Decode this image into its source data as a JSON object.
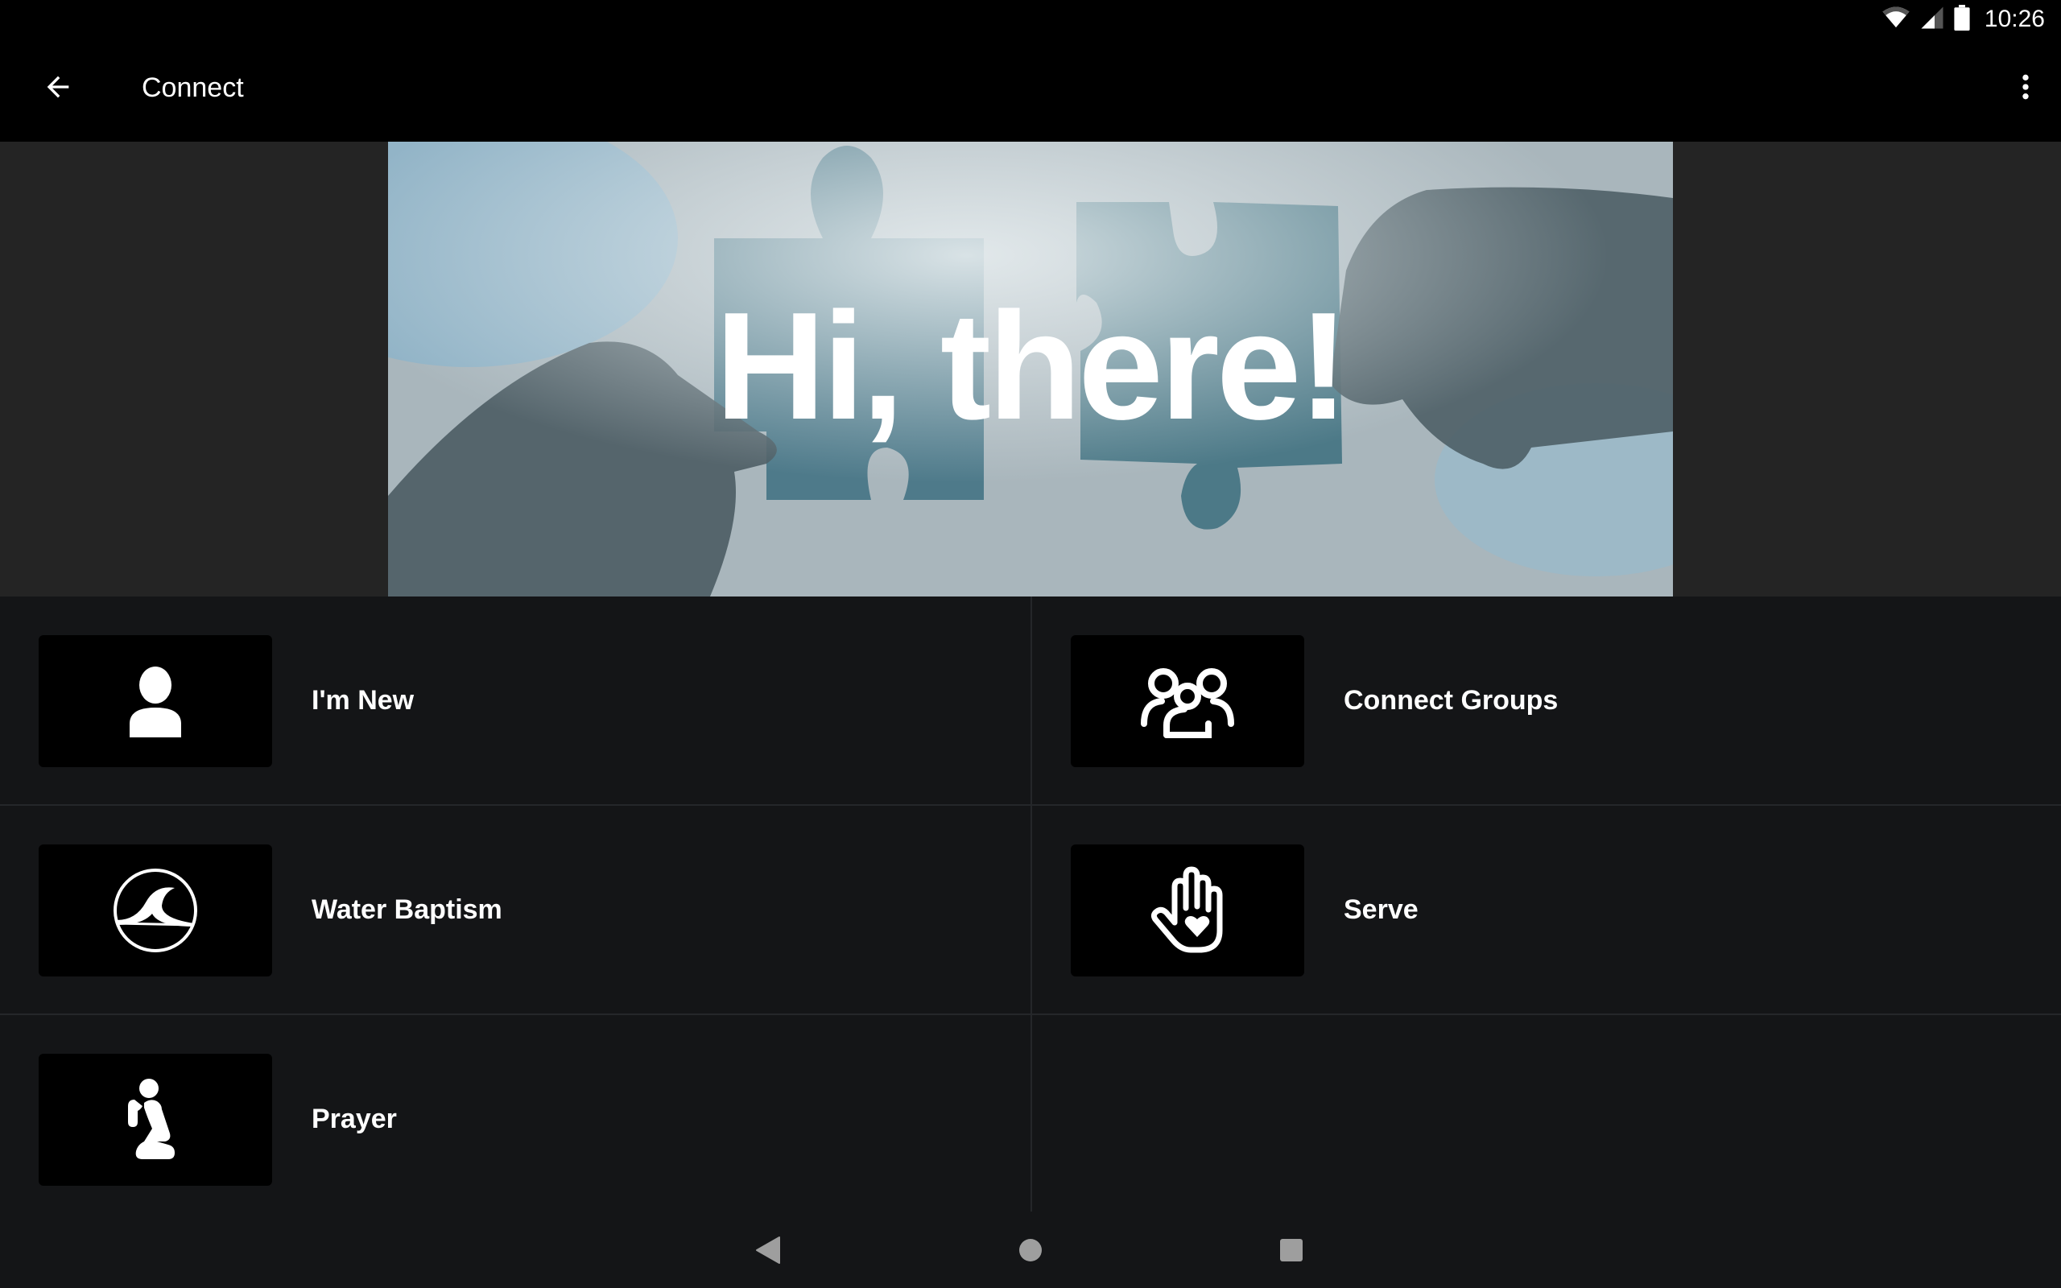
{
  "status_bar": {
    "time": "10:26",
    "icons": [
      "wifi-icon",
      "cell-signal-icon",
      "battery-icon"
    ]
  },
  "app_bar": {
    "title": "Connect",
    "back_icon": "arrow-left-icon",
    "menu_icon": "more-vertical-icon"
  },
  "banner": {
    "headline": "Hi, there!",
    "image_description": "two hands joining puzzle pieces against sky"
  },
  "items": [
    {
      "label": "I'm New",
      "icon": "person-icon"
    },
    {
      "label": "Connect Groups",
      "icon": "group-icon"
    },
    {
      "label": "Water Baptism",
      "icon": "wave-circle-icon"
    },
    {
      "label": "Serve",
      "icon": "hand-heart-icon"
    },
    {
      "label": "Prayer",
      "icon": "praying-person-icon"
    }
  ],
  "nav_bar": {
    "back": "nav-back-icon",
    "home": "nav-home-icon",
    "recents": "nav-recents-icon"
  },
  "colors": {
    "background": "#141517",
    "app_bar": "#000000",
    "banner_area": "#242424",
    "divider": "#25272a",
    "nav_icon": "#9e9e9e",
    "text": "#ffffff"
  }
}
